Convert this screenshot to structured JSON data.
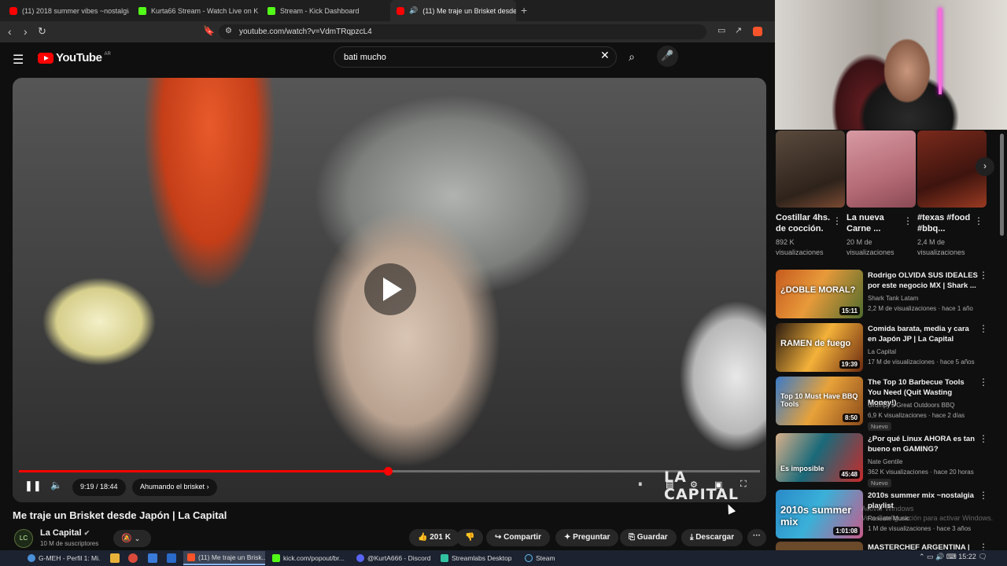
{
  "browser": {
    "tabs": [
      {
        "label": "(11) 2018 summer vibes ~nostalgia p",
        "fav": "yt"
      },
      {
        "label": "Kurta66 Stream - Watch Live on K",
        "fav": "k"
      },
      {
        "label": "Stream - Kick Dashboard",
        "fav": "k"
      },
      {
        "label": "(11) Me traje un Brisket desde",
        "fav": "yt"
      }
    ],
    "new_tab": "+",
    "url": "youtube.com/watch?v=VdmTRqpzcL4"
  },
  "youtube": {
    "logo": "YouTube",
    "logo_country": "AR",
    "search_value": "bati mucho"
  },
  "player": {
    "time": "9:19 / 18:44",
    "chapter": "Ahumando el brisket",
    "progress": 0.498,
    "watermark": "LA CAPITAL"
  },
  "video": {
    "title": "Me traje un Brisket desde Japón | La Capital",
    "channel": "La Capital",
    "subscribers": "10 M de suscriptores",
    "channel_avatar": "LC",
    "likes": "201 K",
    "share": "Compartir",
    "ask": "Preguntar",
    "save": "Guardar",
    "download": "Descargar"
  },
  "shorts": [
    {
      "title": "Costillar 4hs. de cocción.",
      "views": "892 K visualizaciones"
    },
    {
      "title": "La nueva Carne ...",
      "views": "20 M de visualizaciones"
    },
    {
      "title": "#texas #food #bbq...",
      "views": "2,4 M de visualizaciones"
    }
  ],
  "recommendations": [
    {
      "title": "Rodrigo OLVIDA SUS IDEALES por este negocio MX | Shark ...",
      "channel": "Shark Tank Latam",
      "meta": "2,2 M de visualizaciones · hace 1 año",
      "duration": "15:11",
      "thumb_text": "¿DOBLE MORAL?",
      "badge": ""
    },
    {
      "title": "Comida barata, media y cara en Japón JP | La Capital",
      "channel": "La Capital",
      "meta": "17 M de visualizaciones · hace 5 años",
      "duration": "19:39",
      "thumb_text": "RAMEN de fuego",
      "badge": ""
    },
    {
      "title": "The Top 10 Barbecue Tools You Need (Quit Wasting Money!)",
      "channel": "Grumpy's Great Outdoors BBQ",
      "meta": "6,9 K visualizaciones · hace 2 días",
      "duration": "8:50",
      "thumb_text": "Top 10 Must Have BBQ Tools",
      "badge": "Nuevo"
    },
    {
      "title": "¿Por qué Linux AHORA es tan bueno en GAMING?",
      "channel": "Nate Gentile",
      "meta": "362 K visualizaciones · hace 20 horas",
      "duration": "45:48",
      "thumb_text": "Es imposible",
      "badge": "Nuevo"
    },
    {
      "title": "2010s summer mix ~nostalgia playlist",
      "channel": "Roseate Music",
      "meta": "1 M de visualizaciones · hace 3 años",
      "duration": "1:01:08",
      "thumb_text": "2010s summer mix",
      "badge": ""
    },
    {
      "title": "MASTERCHEF ARGENTINA |",
      "channel": "",
      "meta": "",
      "duration": "",
      "thumb_text": "",
      "badge": ""
    }
  ],
  "windows_activation": {
    "line1": "Activar Windows",
    "line2": "Ve a Configuración para activar Windows."
  },
  "taskbar": {
    "items": [
      {
        "label": "G-MEH - Perfil 1: Mi..."
      },
      {
        "label": "(11) Me traje un Brisk..."
      },
      {
        "label": "kick.com/popout/br..."
      },
      {
        "label": "@KurtA666 - Discord"
      },
      {
        "label": "Streamlabs Desktop"
      },
      {
        "label": "Steam"
      }
    ],
    "clock": "15:22"
  },
  "colors": {
    "accent": "#ff0000",
    "kick": "#53fc18",
    "background": "#0f0f0f"
  }
}
